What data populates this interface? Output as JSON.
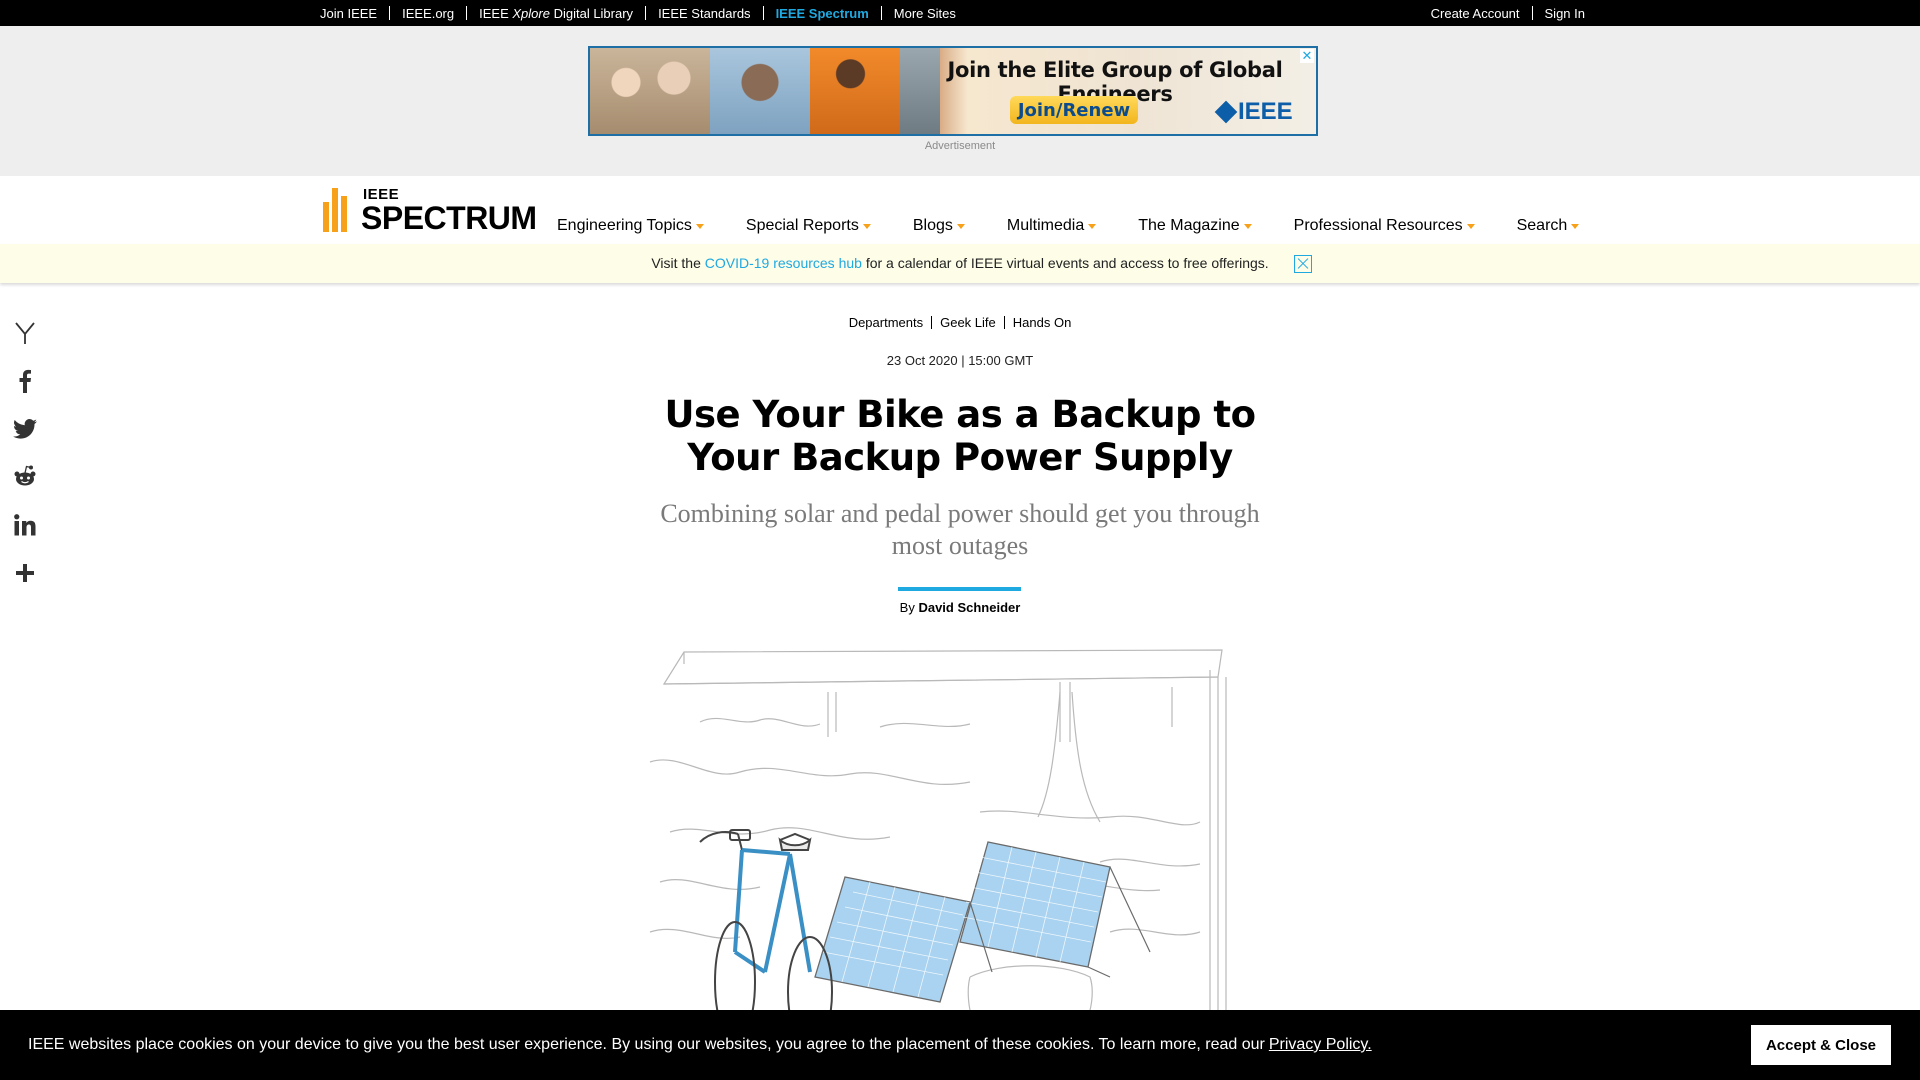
{
  "topbar": {
    "links": [
      "Join IEEE",
      "IEEE.org",
      "IEEE",
      "Xplore",
      "Digital Library",
      "IEEE Standards",
      "IEEE Spectrum",
      "More Sites"
    ],
    "join": "Join IEEE",
    "ieee_org": "IEEE.org",
    "xplore_prefix": "IEEE",
    "xplore_italic": "Xplore",
    "xplore_suffix": "Digital Library",
    "standards": "IEEE Standards",
    "spectrum": "IEEE Spectrum",
    "more_sites": "More Sites",
    "create_account": "Create Account",
    "sign_in": "Sign In",
    "active_color": "#1fa9e1"
  },
  "ad": {
    "headline": "Join the Elite Group of Global Engineers",
    "button": "Join/Renew",
    "logo": "IEEE",
    "close": "✕",
    "label": "Advertisement"
  },
  "nav": {
    "logo_top": "IEEE",
    "logo_main": "SPECTRUM",
    "items": [
      "Engineering Topics",
      "Special Reports",
      "Blogs",
      "Multimedia",
      "The Magazine",
      "Professional Resources",
      "Search"
    ],
    "accent": "#f7a11a"
  },
  "covid": {
    "prefix": "Visit the",
    "link": "COVID-19 resources hub",
    "suffix": "for a calendar of IEEE virtual events and access to free offerings."
  },
  "share": {
    "icons": [
      "hacker-news-icon",
      "facebook-icon",
      "twitter-icon",
      "reddit-icon",
      "linkedin-icon",
      "more-share-icon"
    ]
  },
  "article": {
    "crumbs": [
      "Departments",
      "Geek Life",
      "Hands On"
    ],
    "date": "23 Oct 2020 | 15:00 GMT",
    "title": "Use Your Bike as a Backup to Your Backup Power Supply",
    "subtitle": "Combining solar and pedal power should get you through most outages",
    "by": "By",
    "author": "David Schneider"
  },
  "cookie": {
    "text": "IEEE websites place cookies on your device to give you the best user experience. By using our websites, you agree to the placement of these cookies. To learn more, read our",
    "link": "Privacy Policy.",
    "button": "Accept & Close"
  }
}
